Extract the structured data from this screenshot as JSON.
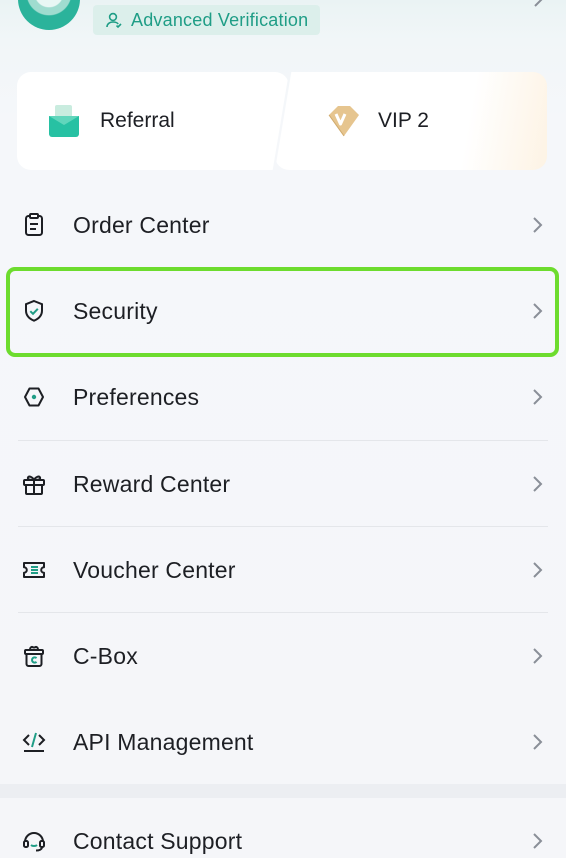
{
  "header": {
    "verification_label": "Advanced Verification",
    "avatar_icon": "avatar-icon",
    "verification_icon": "user-check-icon",
    "accent_color": "#1f9d86"
  },
  "cards": [
    {
      "label": "Referral",
      "icon": "referral-icon"
    },
    {
      "label": "VIP 2",
      "icon": "vip-icon"
    }
  ],
  "menu": {
    "items": [
      {
        "label": "Order Center",
        "icon": "order-icon"
      },
      {
        "label": "Security",
        "icon": "shield-icon",
        "highlighted": true
      },
      {
        "label": "Preferences",
        "icon": "settings-icon"
      },
      {
        "label": "Reward Center",
        "icon": "gift-icon"
      },
      {
        "label": "Voucher Center",
        "icon": "voucher-icon"
      },
      {
        "label": "C-Box",
        "icon": "cbox-icon"
      },
      {
        "label": "API Management",
        "icon": "code-icon"
      }
    ],
    "support": {
      "label": "Contact Support",
      "icon": "headset-icon"
    }
  },
  "colors": {
    "highlight": "#6ddc2e",
    "text": "#1d1f24",
    "chevron": "#8a8f98"
  }
}
